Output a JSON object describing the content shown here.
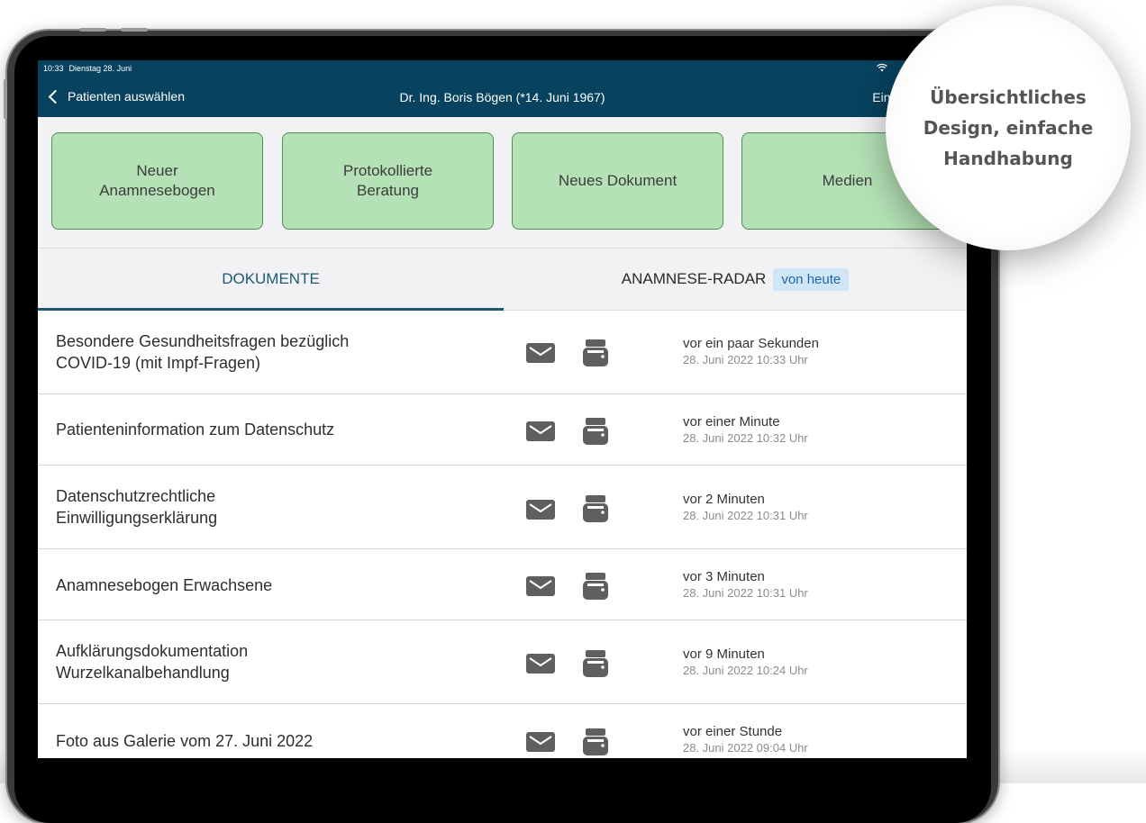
{
  "status_bar": {
    "time": "10:33",
    "date": "Dienstag 28. Juni",
    "wifi_icon": "wifi-icon"
  },
  "navbar": {
    "back_label": "Patienten auswählen",
    "title": "Dr. Ing. Boris Bögen (*14. Juni 1967)",
    "settings_label": "Einstellun"
  },
  "actions": [
    {
      "label": "Neuer\nAnamnesebogen"
    },
    {
      "label": "Protokollierte\nBeratung"
    },
    {
      "label": "Neues Dokument"
    },
    {
      "label": "Medien"
    }
  ],
  "tabs": {
    "documents": "DOKUMENTE",
    "radar": "ANAMNESE-RADAR",
    "radar_badge": "von heute"
  },
  "documents": [
    {
      "title": "Besondere Gesundheitsfragen bezüglich\nCOVID-19 (mit Impf-Fragen)",
      "relative": "vor ein paar Sekunden",
      "timestamp": "28. Juni 2022 10:33 Uhr"
    },
    {
      "title": "Patienteninformation zum Datenschutz",
      "relative": "vor einer Minute",
      "timestamp": "28. Juni 2022 10:32 Uhr"
    },
    {
      "title": "Datenschutzrechtliche\nEinwilligungserklärung",
      "relative": "vor 2 Minuten",
      "timestamp": "28. Juni 2022 10:31 Uhr"
    },
    {
      "title": "Anamnesebogen Erwachsene",
      "relative": "vor 3 Minuten",
      "timestamp": "28. Juni 2022 10:31 Uhr"
    },
    {
      "title": "Aufklärungsdokumentation\nWurzelkanalbehandlung",
      "relative": "vor 9 Minuten",
      "timestamp": "28. Juni 2022 10:24 Uhr"
    },
    {
      "title": "Foto aus Galerie vom 27. Juni 2022",
      "relative": "vor einer Stunde",
      "timestamp": "28. Juni 2022 09:04 Uhr"
    }
  ],
  "callout": {
    "text": "Übersichtliches\nDesign, einfache\nHandhabung"
  },
  "colors": {
    "navbar": "#07425f",
    "action_button": "#b4e2b6",
    "action_border": "#4f8f52",
    "tab_active": "#1f5a75",
    "badge_bg": "#cfe5f8"
  }
}
